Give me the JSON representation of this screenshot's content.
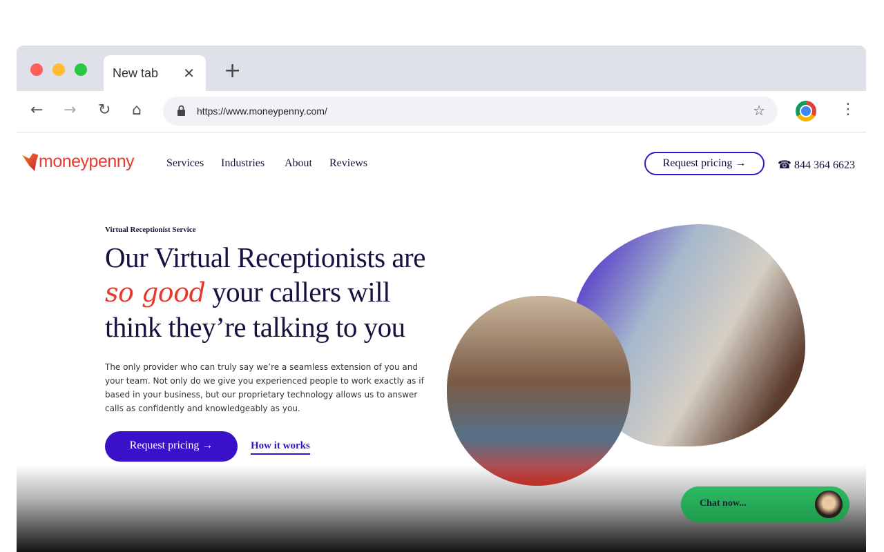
{
  "browser": {
    "tab_title": "New tab",
    "url": "https://www.moneypenny.com/"
  },
  "site": {
    "logo": "moneypenny",
    "nav": [
      "Services",
      "Industries",
      "About",
      "Reviews"
    ],
    "request_pricing": "Request pricing →",
    "phone": "844 364 6623"
  },
  "hero": {
    "eyebrow": "Virtual Receptionist Service",
    "h1_a": "Our Virtual Receptionists are ",
    "h1_em": "so good",
    "h1_b": " your callers will think they’re talking to you",
    "body": "The only provider who can truly say we’re a seamless extension of you and your team. Not only do we give you experienced people to work exactly as if based in your business, but our proprietary technology allows us to answer calls as confidently and knowledgeably as you.",
    "cta": "Request pricing  →",
    "secondary": "How it works"
  },
  "chat": {
    "label": "Chat now..."
  },
  "colors": {
    "brand": "#e8392f",
    "accent": "#3a10c8",
    "chat": "#2dbb62"
  }
}
